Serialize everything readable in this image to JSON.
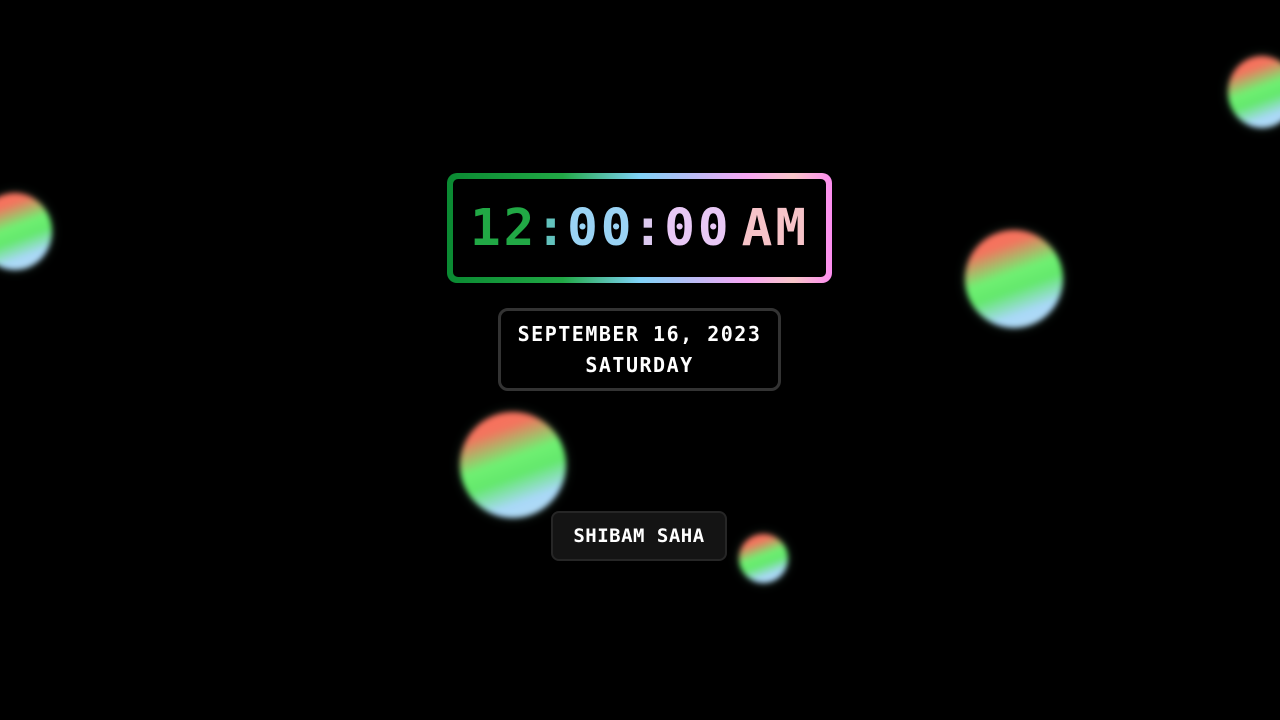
{
  "clock": {
    "hours": "12",
    "separator": ":",
    "minutes": "00",
    "seconds": "00",
    "ampm": "AM"
  },
  "date": {
    "full_date": "SEPTEMBER 16, 2023",
    "weekday": "SATURDAY"
  },
  "author": {
    "name": "SHIBAM SAHA"
  },
  "theme": {
    "background": "#000000",
    "gradient_colors": [
      "#0a8a32",
      "#21a845",
      "#7fd2f7",
      "#f7a6f3",
      "#fd8cf0"
    ],
    "orb_colors": [
      "#ff6b5b",
      "#6ff072",
      "#a9d8f8"
    ]
  }
}
